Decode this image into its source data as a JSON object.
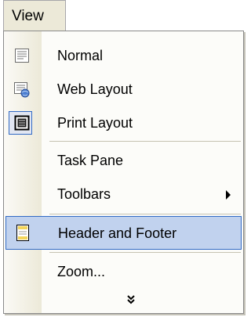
{
  "menubar": {
    "title": "View"
  },
  "menu": {
    "items": [
      {
        "label": "Normal",
        "icon": "normal-view-icon"
      },
      {
        "label": "Web Layout",
        "icon": "web-layout-icon"
      },
      {
        "label": "Print Layout",
        "icon": "print-layout-icon",
        "checked": true
      },
      {
        "label": "Task Pane"
      },
      {
        "label": "Toolbars",
        "submenu": true
      },
      {
        "label": "Header and Footer",
        "icon": "header-footer-icon",
        "highlighted": true
      },
      {
        "label": "Zoom..."
      }
    ],
    "expand_icon": "double-chevron-down-icon"
  },
  "colors": {
    "highlight_fill": "#c1d2ee",
    "highlight_border": "#316ac5",
    "gutter": "#ece9d8",
    "menu_background": "#fcfcf9"
  }
}
